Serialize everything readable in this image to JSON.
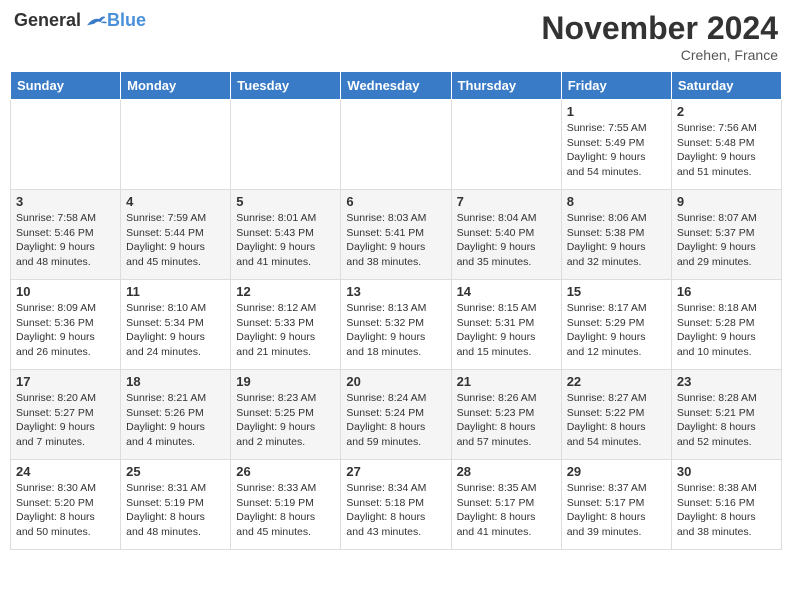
{
  "logo": {
    "general": "General",
    "blue": "Blue"
  },
  "header": {
    "month": "November 2024",
    "location": "Crehen, France"
  },
  "weekdays": [
    "Sunday",
    "Monday",
    "Tuesday",
    "Wednesday",
    "Thursday",
    "Friday",
    "Saturday"
  ],
  "weeks": [
    [
      null,
      null,
      null,
      null,
      null,
      {
        "day": "1",
        "sunrise": "7:55 AM",
        "sunset": "5:49 PM",
        "daylight": "9 hours and 54 minutes."
      },
      {
        "day": "2",
        "sunrise": "7:56 AM",
        "sunset": "5:48 PM",
        "daylight": "9 hours and 51 minutes."
      }
    ],
    [
      {
        "day": "3",
        "sunrise": "7:58 AM",
        "sunset": "5:46 PM",
        "daylight": "9 hours and 48 minutes."
      },
      {
        "day": "4",
        "sunrise": "7:59 AM",
        "sunset": "5:44 PM",
        "daylight": "9 hours and 45 minutes."
      },
      {
        "day": "5",
        "sunrise": "8:01 AM",
        "sunset": "5:43 PM",
        "daylight": "9 hours and 41 minutes."
      },
      {
        "day": "6",
        "sunrise": "8:03 AM",
        "sunset": "5:41 PM",
        "daylight": "9 hours and 38 minutes."
      },
      {
        "day": "7",
        "sunrise": "8:04 AM",
        "sunset": "5:40 PM",
        "daylight": "9 hours and 35 minutes."
      },
      {
        "day": "8",
        "sunrise": "8:06 AM",
        "sunset": "5:38 PM",
        "daylight": "9 hours and 32 minutes."
      },
      {
        "day": "9",
        "sunrise": "8:07 AM",
        "sunset": "5:37 PM",
        "daylight": "9 hours and 29 minutes."
      }
    ],
    [
      {
        "day": "10",
        "sunrise": "8:09 AM",
        "sunset": "5:36 PM",
        "daylight": "9 hours and 26 minutes."
      },
      {
        "day": "11",
        "sunrise": "8:10 AM",
        "sunset": "5:34 PM",
        "daylight": "9 hours and 24 minutes."
      },
      {
        "day": "12",
        "sunrise": "8:12 AM",
        "sunset": "5:33 PM",
        "daylight": "9 hours and 21 minutes."
      },
      {
        "day": "13",
        "sunrise": "8:13 AM",
        "sunset": "5:32 PM",
        "daylight": "9 hours and 18 minutes."
      },
      {
        "day": "14",
        "sunrise": "8:15 AM",
        "sunset": "5:31 PM",
        "daylight": "9 hours and 15 minutes."
      },
      {
        "day": "15",
        "sunrise": "8:17 AM",
        "sunset": "5:29 PM",
        "daylight": "9 hours and 12 minutes."
      },
      {
        "day": "16",
        "sunrise": "8:18 AM",
        "sunset": "5:28 PM",
        "daylight": "9 hours and 10 minutes."
      }
    ],
    [
      {
        "day": "17",
        "sunrise": "8:20 AM",
        "sunset": "5:27 PM",
        "daylight": "9 hours and 7 minutes."
      },
      {
        "day": "18",
        "sunrise": "8:21 AM",
        "sunset": "5:26 PM",
        "daylight": "9 hours and 4 minutes."
      },
      {
        "day": "19",
        "sunrise": "8:23 AM",
        "sunset": "5:25 PM",
        "daylight": "9 hours and 2 minutes."
      },
      {
        "day": "20",
        "sunrise": "8:24 AM",
        "sunset": "5:24 PM",
        "daylight": "8 hours and 59 minutes."
      },
      {
        "day": "21",
        "sunrise": "8:26 AM",
        "sunset": "5:23 PM",
        "daylight": "8 hours and 57 minutes."
      },
      {
        "day": "22",
        "sunrise": "8:27 AM",
        "sunset": "5:22 PM",
        "daylight": "8 hours and 54 minutes."
      },
      {
        "day": "23",
        "sunrise": "8:28 AM",
        "sunset": "5:21 PM",
        "daylight": "8 hours and 52 minutes."
      }
    ],
    [
      {
        "day": "24",
        "sunrise": "8:30 AM",
        "sunset": "5:20 PM",
        "daylight": "8 hours and 50 minutes."
      },
      {
        "day": "25",
        "sunrise": "8:31 AM",
        "sunset": "5:19 PM",
        "daylight": "8 hours and 48 minutes."
      },
      {
        "day": "26",
        "sunrise": "8:33 AM",
        "sunset": "5:19 PM",
        "daylight": "8 hours and 45 minutes."
      },
      {
        "day": "27",
        "sunrise": "8:34 AM",
        "sunset": "5:18 PM",
        "daylight": "8 hours and 43 minutes."
      },
      {
        "day": "28",
        "sunrise": "8:35 AM",
        "sunset": "5:17 PM",
        "daylight": "8 hours and 41 minutes."
      },
      {
        "day": "29",
        "sunrise": "8:37 AM",
        "sunset": "5:17 PM",
        "daylight": "8 hours and 39 minutes."
      },
      {
        "day": "30",
        "sunrise": "8:38 AM",
        "sunset": "5:16 PM",
        "daylight": "8 hours and 38 minutes."
      }
    ]
  ]
}
